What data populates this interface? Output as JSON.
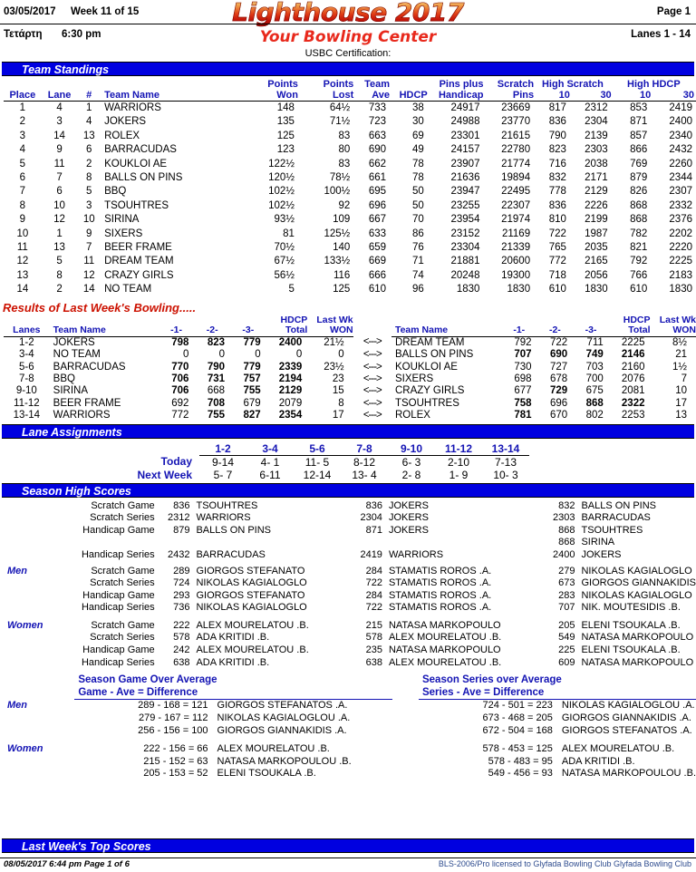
{
  "header": {
    "date": "03/05/2017",
    "week": "Week 11 of 15",
    "page": "Page 1",
    "day": "Τετάρτη",
    "time": "6:30 pm",
    "lanes": "Lanes 1 - 14",
    "logo": "Lighthouse 2017",
    "subtitle": "Your Bowling Center",
    "certification": "USBC Certification:"
  },
  "sections": {
    "team_standings": "Team Standings",
    "lane_assignments": "Lane Assignments",
    "season_high_scores": "Season High Scores",
    "last_week_top_scores": "Last Week's Top Scores",
    "results_title": "Results of Last Week's Bowling....."
  },
  "standings": {
    "headers": {
      "place": "Place",
      "lane": "Lane",
      "num": "#",
      "team": "Team Name",
      "points_won_1": "Points",
      "points_won_2": "Won",
      "points_lost_1": "Points",
      "points_lost_2": "Lost",
      "team_1": "Team",
      "team_2": "Ave",
      "hdcp": "HDCP",
      "pins_1": "Pins plus",
      "pins_2": "Handicap",
      "scratch_1": "Scratch",
      "scratch_2": "Pins",
      "high_scratch": "High Scratch",
      "hs_10": "10",
      "hs_30": "30",
      "high_hdcp": "High HDCP",
      "hh_10": "10",
      "hh_30": "30"
    },
    "rows": [
      {
        "place": "1",
        "lane": "4",
        "num": "1",
        "team": "WARRIORS",
        "won": "148",
        "lost": "64½",
        "ave": "733",
        "hdcp": "38",
        "pins": "24917",
        "scratch": "23669",
        "hs10": "817",
        "hs30": "2312",
        "hh10": "853",
        "hh30": "2419"
      },
      {
        "place": "2",
        "lane": "3",
        "num": "4",
        "team": "JOKERS",
        "won": "135",
        "lost": "71½",
        "ave": "723",
        "hdcp": "30",
        "pins": "24988",
        "scratch": "23770",
        "hs10": "836",
        "hs30": "2304",
        "hh10": "871",
        "hh30": "2400"
      },
      {
        "place": "3",
        "lane": "14",
        "num": "13",
        "team": "ROLEX",
        "won": "125",
        "lost": "83",
        "ave": "663",
        "hdcp": "69",
        "pins": "23301",
        "scratch": "21615",
        "hs10": "790",
        "hs30": "2139",
        "hh10": "857",
        "hh30": "2340"
      },
      {
        "place": "4",
        "lane": "9",
        "num": "6",
        "team": "BARRACUDAS",
        "won": "123",
        "lost": "80",
        "ave": "690",
        "hdcp": "49",
        "pins": "24157",
        "scratch": "22780",
        "hs10": "823",
        "hs30": "2303",
        "hh10": "866",
        "hh30": "2432"
      },
      {
        "place": "5",
        "lane": "11",
        "num": "2",
        "team": "KOUKLOI AE",
        "won": "122½",
        "lost": "83",
        "ave": "662",
        "hdcp": "78",
        "pins": "23907",
        "scratch": "21774",
        "hs10": "716",
        "hs30": "2038",
        "hh10": "769",
        "hh30": "2260"
      },
      {
        "place": "6",
        "lane": "7",
        "num": "8",
        "team": "BALLS ON PINS",
        "won": "120½",
        "lost": "78½",
        "ave": "661",
        "hdcp": "78",
        "pins": "21636",
        "scratch": "19894",
        "hs10": "832",
        "hs30": "2171",
        "hh10": "879",
        "hh30": "2344"
      },
      {
        "place": "7",
        "lane": "6",
        "num": "5",
        "team": "BBQ",
        "won": "102½",
        "lost": "100½",
        "ave": "695",
        "hdcp": "50",
        "pins": "23947",
        "scratch": "22495",
        "hs10": "778",
        "hs30": "2129",
        "hh10": "826",
        "hh30": "2307"
      },
      {
        "place": "8",
        "lane": "10",
        "num": "3",
        "team": "TSOUHTRES",
        "won": "102½",
        "lost": "92",
        "ave": "696",
        "hdcp": "50",
        "pins": "23255",
        "scratch": "22307",
        "hs10": "836",
        "hs30": "2226",
        "hh10": "868",
        "hh30": "2332"
      },
      {
        "place": "9",
        "lane": "12",
        "num": "10",
        "team": "SIRINA",
        "won": "93½",
        "lost": "109",
        "ave": "667",
        "hdcp": "70",
        "pins": "23954",
        "scratch": "21974",
        "hs10": "810",
        "hs30": "2199",
        "hh10": "868",
        "hh30": "2376"
      },
      {
        "place": "10",
        "lane": "1",
        "num": "9",
        "team": "SIXERS",
        "won": "81",
        "lost": "125½",
        "ave": "633",
        "hdcp": "86",
        "pins": "23152",
        "scratch": "21169",
        "hs10": "722",
        "hs30": "1987",
        "hh10": "782",
        "hh30": "2202"
      },
      {
        "place": "11",
        "lane": "13",
        "num": "7",
        "team": "BEER FRAME",
        "won": "70½",
        "lost": "140",
        "ave": "659",
        "hdcp": "76",
        "pins": "23304",
        "scratch": "21339",
        "hs10": "765",
        "hs30": "2035",
        "hh10": "821",
        "hh30": "2220"
      },
      {
        "place": "12",
        "lane": "5",
        "num": "11",
        "team": "DREAM TEAM",
        "won": "67½",
        "lost": "133½",
        "ave": "669",
        "hdcp": "71",
        "pins": "21881",
        "scratch": "20600",
        "hs10": "772",
        "hs30": "2165",
        "hh10": "792",
        "hh30": "2225"
      },
      {
        "place": "13",
        "lane": "8",
        "num": "12",
        "team": "CRAZY GIRLS",
        "won": "56½",
        "lost": "116",
        "ave": "666",
        "hdcp": "74",
        "pins": "20248",
        "scratch": "19300",
        "hs10": "718",
        "hs30": "2056",
        "hh10": "766",
        "hh30": "2183"
      },
      {
        "place": "14",
        "lane": "2",
        "num": "14",
        "team": "NO TEAM",
        "won": "5",
        "lost": "125",
        "ave": "610",
        "hdcp": "96",
        "pins": "1830",
        "scratch": "1830",
        "hs10": "610",
        "hs30": "1830",
        "hh10": "610",
        "hh30": "1830"
      }
    ]
  },
  "results": {
    "headers": {
      "lanes": "Lanes",
      "team": "Team Name",
      "g1": "-1-",
      "g2": "-2-",
      "g3": "-3-",
      "hdcp_1": "HDCP",
      "hdcp_2": "Total",
      "lastwk_1": "Last Wk",
      "lastwk_2": "WON",
      "arrow": "<--->"
    },
    "rows": [
      {
        "lanes": "1-2",
        "home": {
          "team": "JOKERS",
          "g1": "798",
          "g2": "823",
          "g3": "779",
          "total": "2400",
          "won": "21½",
          "b1": true,
          "b2": true,
          "b3": true,
          "bt": true
        },
        "away": {
          "team": "DREAM TEAM",
          "g1": "792",
          "g2": "722",
          "g3": "711",
          "total": "2225",
          "won": "8½",
          "b1": false,
          "b2": false,
          "b3": false,
          "bt": false
        }
      },
      {
        "lanes": "3-4",
        "home": {
          "team": "NO TEAM",
          "g1": "0",
          "g2": "0",
          "g3": "0",
          "total": "0",
          "won": "0",
          "b1": false,
          "b2": false,
          "b3": false,
          "bt": false
        },
        "away": {
          "team": "BALLS ON PINS",
          "g1": "707",
          "g2": "690",
          "g3": "749",
          "total": "2146",
          "won": "21",
          "b1": true,
          "b2": true,
          "b3": true,
          "bt": true
        }
      },
      {
        "lanes": "5-6",
        "home": {
          "team": "BARRACUDAS",
          "g1": "770",
          "g2": "790",
          "g3": "779",
          "total": "2339",
          "won": "23½",
          "b1": true,
          "b2": true,
          "b3": true,
          "bt": true
        },
        "away": {
          "team": "KOUKLOI AE",
          "g1": "730",
          "g2": "727",
          "g3": "703",
          "total": "2160",
          "won": "1½",
          "b1": false,
          "b2": false,
          "b3": false,
          "bt": false
        }
      },
      {
        "lanes": "7-8",
        "home": {
          "team": "BBQ",
          "g1": "706",
          "g2": "731",
          "g3": "757",
          "total": "2194",
          "won": "23",
          "b1": true,
          "b2": true,
          "b3": true,
          "bt": true
        },
        "away": {
          "team": "SIXERS",
          "g1": "698",
          "g2": "678",
          "g3": "700",
          "total": "2076",
          "won": "7",
          "b1": false,
          "b2": false,
          "b3": false,
          "bt": false
        }
      },
      {
        "lanes": "9-10",
        "home": {
          "team": "SIRINA",
          "g1": "706",
          "g2": "668",
          "g3": "755",
          "total": "2129",
          "won": "15",
          "b1": true,
          "b2": false,
          "b3": true,
          "bt": true
        },
        "away": {
          "team": "CRAZY GIRLS",
          "g1": "677",
          "g2": "729",
          "g3": "675",
          "total": "2081",
          "won": "10",
          "b1": false,
          "b2": true,
          "b3": false,
          "bt": false
        }
      },
      {
        "lanes": "11-12",
        "home": {
          "team": "BEER FRAME",
          "g1": "692",
          "g2": "708",
          "g3": "679",
          "total": "2079",
          "won": "8",
          "b1": false,
          "b2": true,
          "b3": false,
          "bt": false
        },
        "away": {
          "team": "TSOUHTRES",
          "g1": "758",
          "g2": "696",
          "g3": "868",
          "total": "2322",
          "won": "17",
          "b1": true,
          "b2": false,
          "b3": true,
          "bt": true
        }
      },
      {
        "lanes": "13-14",
        "home": {
          "team": "WARRIORS",
          "g1": "772",
          "g2": "755",
          "g3": "827",
          "total": "2354",
          "won": "17",
          "b1": false,
          "b2": true,
          "b3": true,
          "bt": true
        },
        "away": {
          "team": "ROLEX",
          "g1": "781",
          "g2": "670",
          "g3": "802",
          "total": "2253",
          "won": "13",
          "b1": true,
          "b2": false,
          "b3": false,
          "bt": false
        }
      }
    ]
  },
  "lane_assignments": {
    "pair_labels": [
      "1-2",
      "3-4",
      "5-6",
      "7-8",
      "9-10",
      "11-12",
      "13-14"
    ],
    "today_label": "Today",
    "next_week_label": "Next Week",
    "today": [
      "9-14",
      "4- 1",
      "11- 5",
      "8-12",
      "6- 3",
      "2-10",
      "7-13"
    ],
    "next_week": [
      "5- 7",
      "6-11",
      "12-14",
      "13- 4",
      "2- 8",
      "1- 9",
      "10- 3"
    ]
  },
  "season_high_scores": {
    "team": [
      {
        "cat": "Scratch Game",
        "c1s": "836",
        "c1n": "TSOUHTRES",
        "c2s": "836",
        "c2n": "JOKERS",
        "c3s": "832",
        "c3n": "BALLS ON PINS"
      },
      {
        "cat": "Scratch Series",
        "c1s": "2312",
        "c1n": "WARRIORS",
        "c2s": "2304",
        "c2n": "JOKERS",
        "c3s": "2303",
        "c3n": "BARRACUDAS"
      },
      {
        "cat": "Handicap Game",
        "c1s": "879",
        "c1n": "BALLS ON PINS",
        "c2s": "871",
        "c2n": "JOKERS",
        "c3s": "868",
        "c3n": "TSOUHTRES"
      },
      {
        "cat": "",
        "c1s": "",
        "c1n": "",
        "c2s": "",
        "c2n": "",
        "c3s": "868",
        "c3n": "SIRINA"
      },
      {
        "cat": "Handicap Series",
        "c1s": "2432",
        "c1n": "BARRACUDAS",
        "c2s": "2419",
        "c2n": "WARRIORS",
        "c3s": "2400",
        "c3n": "JOKERS"
      }
    ],
    "men_label": "Men",
    "men": [
      {
        "cat": "Scratch Game",
        "c1s": "289",
        "c1n": "GIORGOS STEFANATO",
        "c2s": "284",
        "c2n": "STAMATIS ROROS .A.",
        "c3s": "279",
        "c3n": "NIKOLAS KAGIALOGLO"
      },
      {
        "cat": "Scratch Series",
        "c1s": "724",
        "c1n": "NIKOLAS KAGIALOGLO",
        "c2s": "722",
        "c2n": "STAMATIS ROROS .A.",
        "c3s": "673",
        "c3n": "GIORGOS GIANNAKIDIS"
      },
      {
        "cat": "Handicap Game",
        "c1s": "293",
        "c1n": "GIORGOS STEFANATO",
        "c2s": "284",
        "c2n": "STAMATIS ROROS .A.",
        "c3s": "283",
        "c3n": "NIKOLAS KAGIALOGLO"
      },
      {
        "cat": "Handicap Series",
        "c1s": "736",
        "c1n": "NIKOLAS KAGIALOGLO",
        "c2s": "722",
        "c2n": "STAMATIS ROROS .A.",
        "c3s": "707",
        "c3n": "NIK. MOUTESIDIS .B."
      }
    ],
    "women_label": "Women",
    "women": [
      {
        "cat": "Scratch Game",
        "c1s": "222",
        "c1n": "ALEX MOURELATOU .B.",
        "c2s": "215",
        "c2n": "NATASA MARKOPOULO",
        "c3s": "205",
        "c3n": "ELENI TSOUKALA .B."
      },
      {
        "cat": "Scratch Series",
        "c1s": "578",
        "c1n": "ADA KRITIDI .B.",
        "c2s": "578",
        "c2n": "ALEX MOURELATOU .B.",
        "c3s": "549",
        "c3n": "NATASA MARKOPOULO"
      },
      {
        "cat": "Handicap Game",
        "c1s": "242",
        "c1n": "ALEX MOURELATOU .B.",
        "c2s": "235",
        "c2n": "NATASA MARKOPOULO",
        "c3s": "225",
        "c3n": "ELENI TSOUKALA .B."
      },
      {
        "cat": "Handicap Series",
        "c1s": "638",
        "c1n": "ADA KRITIDI .B.",
        "c2s": "638",
        "c2n": "ALEX MOURELATOU .B.",
        "c3s": "609",
        "c3n": "NATASA MARKOPOULO"
      }
    ]
  },
  "over_average": {
    "game_title": "Season Game Over Average",
    "game_subtitle": "Game - Ave = Difference",
    "series_title": "Season Series over Average",
    "series_subtitle": "Series - Ave = Difference",
    "men_label": "Men",
    "women_label": "Women",
    "game_men": [
      {
        "eq": "289 - 168 = 121",
        "name": "GIORGOS STEFANATOS .A."
      },
      {
        "eq": "279 - 167 = 112",
        "name": "NIKOLAS KAGIALOGLOU .A."
      },
      {
        "eq": "256 - 156 = 100",
        "name": "GIORGOS GIANNAKIDIS .A."
      }
    ],
    "game_women": [
      {
        "eq": "222 - 156 = 66",
        "name": "ALEX MOURELATOU .B."
      },
      {
        "eq": "215 - 152 = 63",
        "name": "NATASA MARKOPOULOU .B."
      },
      {
        "eq": "205 - 153 = 52",
        "name": "ELENI TSOUKALA .B."
      }
    ],
    "series_men": [
      {
        "eq": "724 - 501 = 223",
        "name": "NIKOLAS KAGIALOGLOU .A."
      },
      {
        "eq": "673 - 468 = 205",
        "name": "GIORGOS GIANNAKIDIS .A."
      },
      {
        "eq": "672 - 504 = 168",
        "name": "GIORGOS STEFANATOS .A."
      }
    ],
    "series_women": [
      {
        "eq": "578 - 453 = 125",
        "name": "ALEX MOURELATOU .B."
      },
      {
        "eq": "578 - 483 = 95",
        "name": "ADA KRITIDI .B."
      },
      {
        "eq": "549 - 456 = 93",
        "name": "NATASA MARKOPOULOU .B."
      }
    ]
  },
  "footer": {
    "left": "08/05/2017  6:44 pm  Page 1 of 6",
    "right": "BLS-2006/Pro licensed to Glyfada Bowling Club   Glyfada Bowling Club"
  },
  "colors": {
    "section_bar": "#0000e0",
    "heading_blue": "#1414b4",
    "accent_red": "#e8291c",
    "results_red": "#cc1100"
  }
}
